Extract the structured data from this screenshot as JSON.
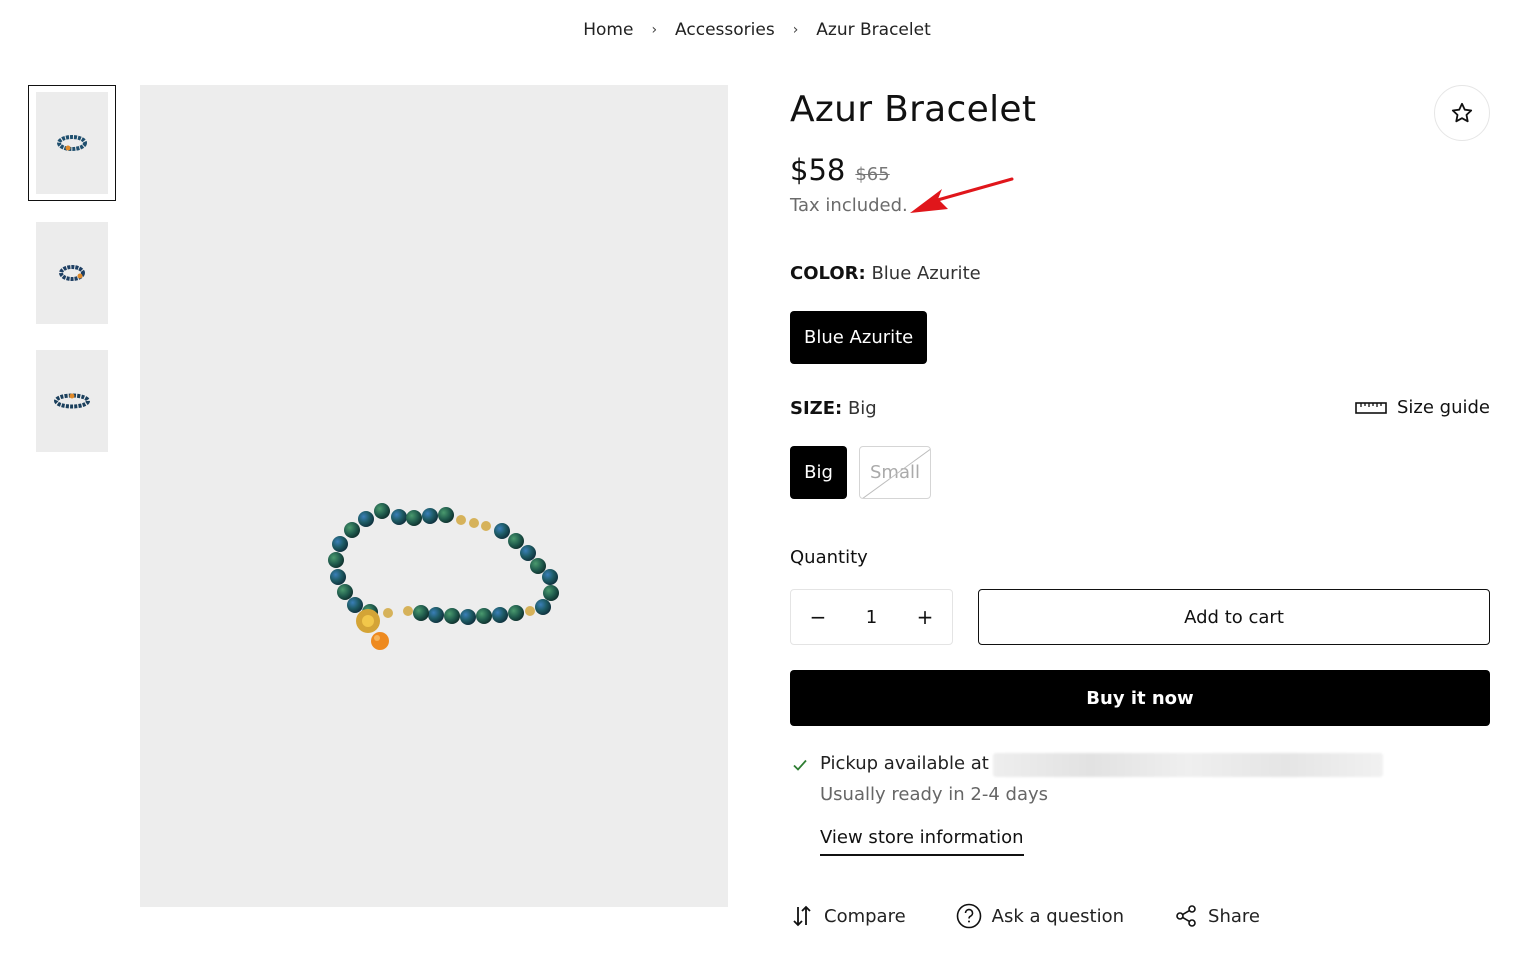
{
  "breadcrumb": {
    "items": [
      "Home",
      "Accessories",
      "Azur Bracelet"
    ],
    "separator": "›"
  },
  "gallery": {
    "thumbnails": [
      "thumbnail-1",
      "thumbnail-2",
      "thumbnail-3"
    ],
    "active_index": 0
  },
  "product": {
    "title": "Azur Bracelet",
    "price": "$58",
    "compare_price": "$65",
    "tax_note": "Tax included."
  },
  "options": {
    "color_label": "COLOR:",
    "color_value": "Blue Azurite",
    "color_swatches": [
      "Blue Azurite"
    ],
    "size_label": "SIZE:",
    "size_value": "Big",
    "size_guide": "Size guide",
    "sizes": [
      "Big",
      "Small"
    ]
  },
  "purchase": {
    "quantity_label": "Quantity",
    "quantity": "1",
    "minus": "−",
    "plus": "+",
    "add_to_cart": "Add to cart",
    "buy_now": "Buy it now"
  },
  "pickup": {
    "available_text": "Pickup available at",
    "ready_text": "Usually ready in 2-4 days",
    "store_link": "View store information"
  },
  "actions": {
    "compare": "Compare",
    "ask": "Ask a question",
    "share": "Share"
  },
  "colors": {
    "primary": "#000000",
    "annotation_arrow": "#e0161b",
    "check": "#2e7d32"
  }
}
